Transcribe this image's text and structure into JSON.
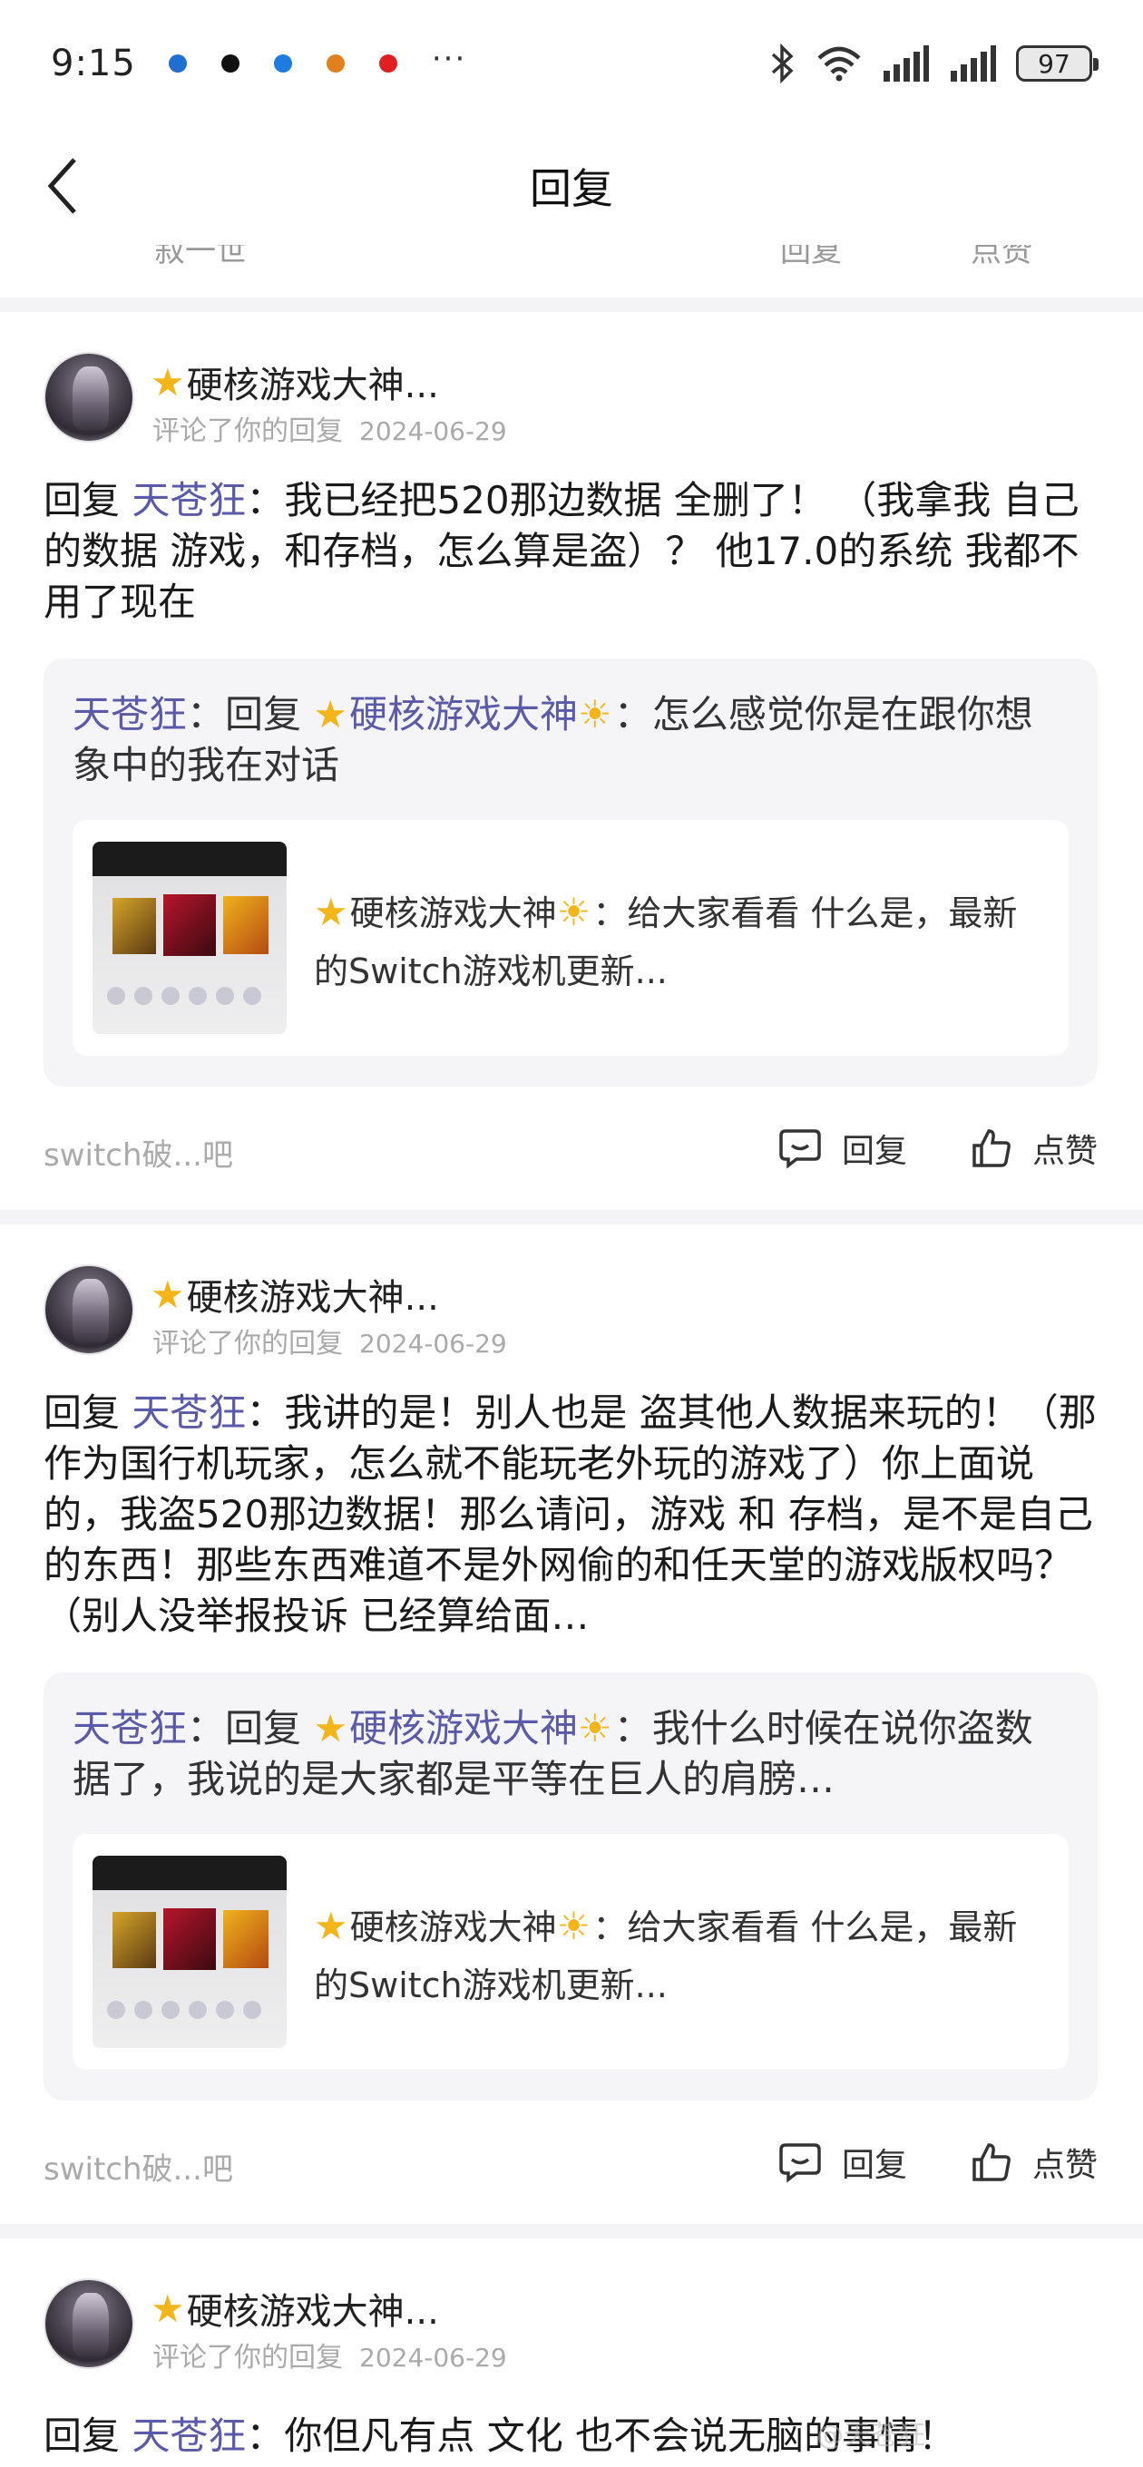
{
  "status_bar": {
    "time": "9:15",
    "notification_colors": [
      "#1f6fd1",
      "#111111",
      "#1e7be0",
      "#e0801f",
      "#e02020"
    ],
    "more": "···",
    "battery": "97"
  },
  "header": {
    "title": "回复"
  },
  "cut_previous": {
    "left": "叙一世",
    "mid": "回复",
    "right": "点赞"
  },
  "posts": [
    {
      "author": "硬核游戏大神...",
      "meta_text": "评论了你的回复",
      "date": "2024-06-29",
      "reply_prefix": "回复 ",
      "mention": "天苍狂",
      "body": "：我已经把520那边数据 全删了！ （我拿我 自己的数据 游戏，和存档，怎么算是盗）？ 他17.0的系统 我都不用了现在",
      "quote": {
        "mention": "天苍狂",
        "sep": "：回复 ",
        "target": "硬核游戏大神",
        "text": "：怎么感觉你是在跟你想象中的我在对话"
      },
      "card": {
        "author": "硬核游戏大神",
        "text": "：给大家看看 什么是，最新的Switch游戏机更新..."
      },
      "tieba": "switch破...吧",
      "reply_label": "回复",
      "like_label": "点赞"
    },
    {
      "author": "硬核游戏大神...",
      "meta_text": "评论了你的回复",
      "date": "2024-06-29",
      "reply_prefix": "回复 ",
      "mention": "天苍狂",
      "body": "：我讲的是！别人也是 盗其他人数据来玩的！（那作为国行机玩家，怎么就不能玩老外玩的游戏了）你上面说的，我盗520那边数据！那么请问，游戏 和 存档，是不是自己的东西！那些东西难道不是外网偷的和任天堂的游戏版权吗？ （别人没举报投诉 已经算给面…",
      "quote": {
        "mention": "天苍狂",
        "sep": "：回复 ",
        "target": "硬核游戏大神",
        "text": "：我什么时候在说你盗数据了，我说的是大家都是平等在巨人的肩膀…"
      },
      "card": {
        "author": "硬核游戏大神",
        "text": "：给大家看看 什么是，最新的Switch游戏机更新..."
      },
      "tieba": "switch破...吧",
      "reply_label": "回复",
      "like_label": "点赞"
    },
    {
      "author": "硬核游戏大神...",
      "meta_text": "评论了你的回复",
      "date": "2024-06-29",
      "reply_prefix": "回复 ",
      "mention": "天苍狂",
      "body": "：你但凡有点 文化 也不会说无脑的事情！"
    }
  ],
  "watermark": "@天苍狂"
}
